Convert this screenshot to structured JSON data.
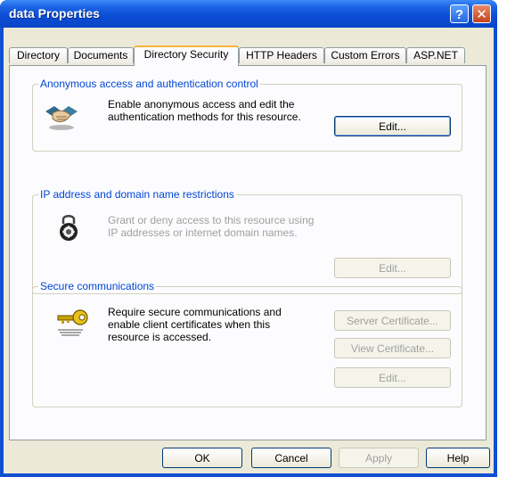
{
  "window": {
    "title": "data Properties"
  },
  "tabs": [
    {
      "label": "Directory"
    },
    {
      "label": "Documents"
    },
    {
      "label": "Directory Security"
    },
    {
      "label": "HTTP Headers"
    },
    {
      "label": "Custom Errors"
    },
    {
      "label": "ASP.NET"
    }
  ],
  "groups": {
    "anonymous": {
      "title": "Anonymous access and authentication control",
      "description_line1": "Enable anonymous access and edit the",
      "description_line2": "authentication methods for this resource.",
      "edit_label": "Edit..."
    },
    "ip": {
      "title": "IP address and domain name restrictions",
      "description_line1": "Grant or deny access to this resource using",
      "description_line2": "IP addresses or internet domain names.",
      "edit_label": "Edit..."
    },
    "secure": {
      "title": "Secure communications",
      "description_line1": "Require secure communications and",
      "description_line2": "enable client certificates when this",
      "description_line3": "resource is accessed.",
      "server_cert_label": "Server Certificate...",
      "view_cert_label": "View Certificate...",
      "edit_label": "Edit..."
    }
  },
  "footer": {
    "ok_label": "OK",
    "cancel_label": "Cancel",
    "apply_label": "Apply",
    "help_label": "Help"
  },
  "icons": {
    "help": "?",
    "close": "✕",
    "handshake": "handshake-icon",
    "lock": "padlock-icon",
    "key": "key-icon"
  },
  "colors": {
    "titlebar": "#0a4cd4",
    "group_title": "#0046d5",
    "disabled_text": "#a0a0a0"
  }
}
